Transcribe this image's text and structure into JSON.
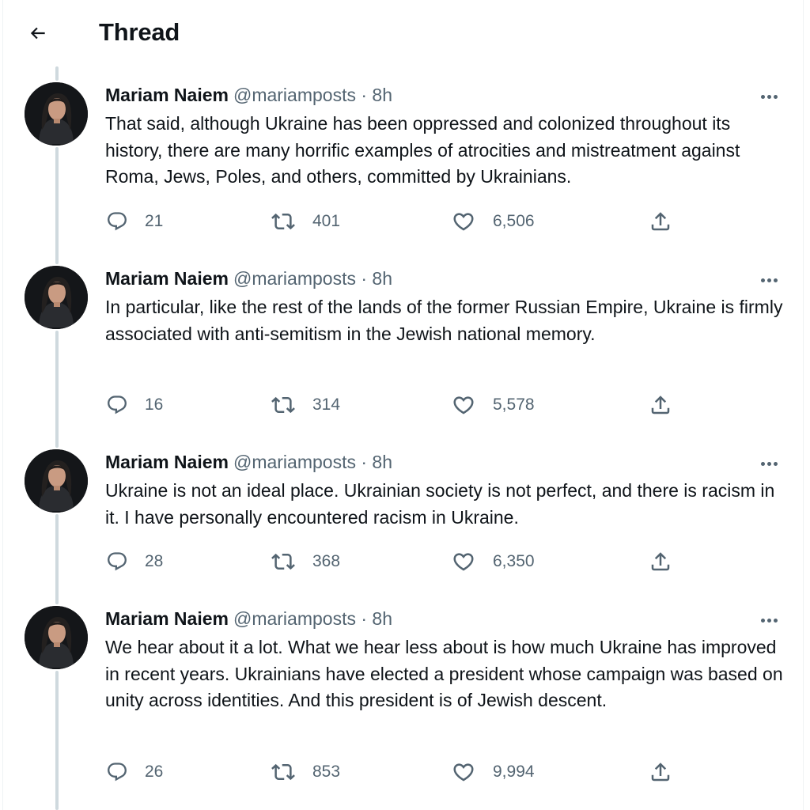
{
  "header": {
    "title": "Thread",
    "back_icon": "arrow-left-icon"
  },
  "colors": {
    "text_primary": "#0f1419",
    "text_secondary": "#536471",
    "thread_line": "#cfd9de"
  },
  "tweets": [
    {
      "author_name": "Mariam Naiem",
      "handle": "@mariamposts",
      "separator": "·",
      "time": "8h",
      "text": "That said, although Ukraine has been oppressed and colonized throughout its history, there are many horrific examples of atrocities and mistreatment against Roma, Jews, Poles, and others, committed by Ukrainians.",
      "replies": "21",
      "retweets": "401",
      "likes": "6,506"
    },
    {
      "author_name": "Mariam Naiem",
      "handle": "@mariamposts",
      "separator": "·",
      "time": "8h",
      "text": "In particular, like the rest of the lands of the former Russian Empire, Ukraine is firmly associated with anti-semitism in the Jewish national memory.",
      "replies": "16",
      "retweets": "314",
      "likes": "5,578"
    },
    {
      "author_name": "Mariam Naiem",
      "handle": "@mariamposts",
      "separator": "·",
      "time": "8h",
      "text": "Ukraine is not an ideal place. Ukrainian society is not perfect, and there is racism in it. I have personally encountered racism in Ukraine.",
      "replies": "28",
      "retweets": "368",
      "likes": "6,350"
    },
    {
      "author_name": "Mariam Naiem",
      "handle": "@mariamposts",
      "separator": "·",
      "time": "8h",
      "text": "We hear about it a lot. What we hear less about is how much Ukraine has improved in recent years. Ukrainians have elected a president whose campaign was based on unity across identities. And this president is of Jewish descent.",
      "replies": "26",
      "retweets": "853",
      "likes": "9,994"
    }
  ],
  "icons": {
    "reply": "reply-icon",
    "retweet": "retweet-icon",
    "like": "heart-icon",
    "share": "share-icon",
    "more": "more-icon"
  }
}
